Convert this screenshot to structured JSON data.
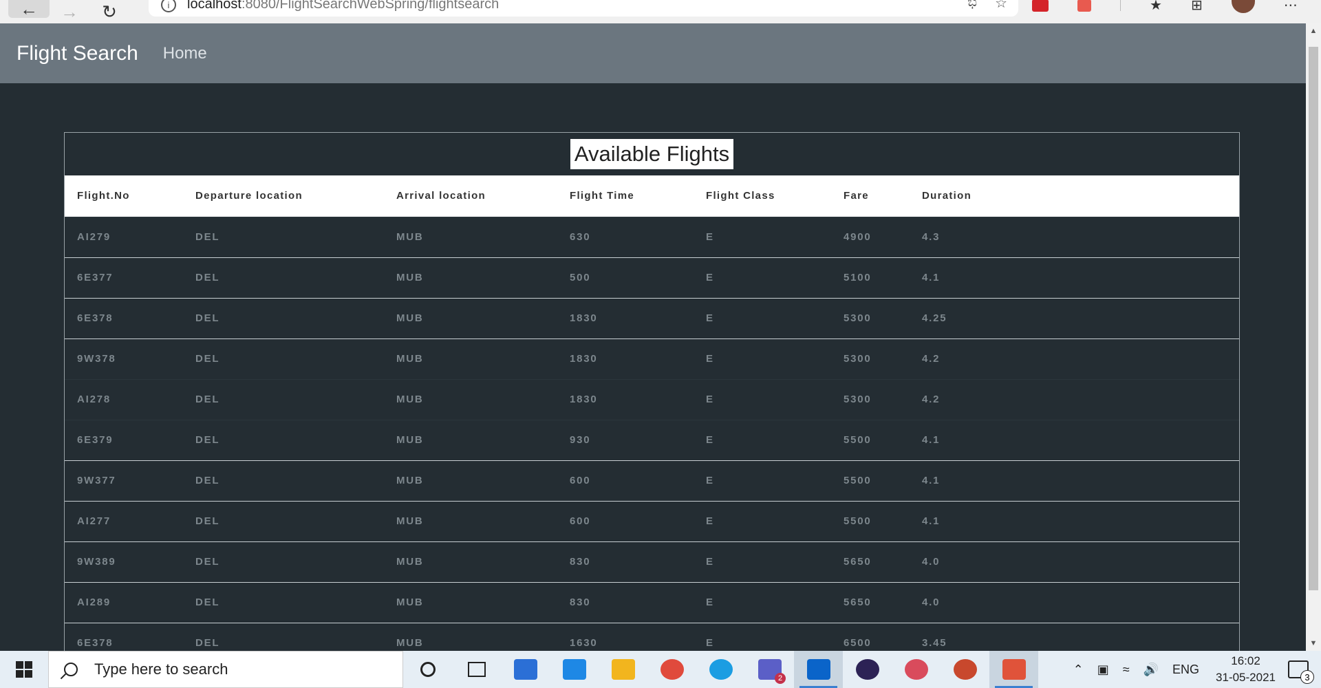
{
  "browser": {
    "url_host": "localhost",
    "url_path": ":8080/FlightSearchWebSpring/flightsearch"
  },
  "navbar": {
    "brand": "Flight Search",
    "home_link": "Home"
  },
  "table": {
    "caption": "Available Flights",
    "columns": [
      "Flight.No",
      "Departure location",
      "Arrival location",
      "Flight Time",
      "Flight Class",
      "Fare",
      "Duration"
    ],
    "rows": [
      [
        "AI279",
        "DEL",
        "MUB",
        "630",
        "E",
        "4900",
        "4.3"
      ],
      [
        "6E377",
        "DEL",
        "MUB",
        "500",
        "E",
        "5100",
        "4.1"
      ],
      [
        "6E378",
        "DEL",
        "MUB",
        "1830",
        "E",
        "5300",
        "4.25"
      ],
      [
        "9W378",
        "DEL",
        "MUB",
        "1830",
        "E",
        "5300",
        "4.2"
      ],
      [
        "AI278",
        "DEL",
        "MUB",
        "1830",
        "E",
        "5300",
        "4.2"
      ],
      [
        "6E379",
        "DEL",
        "MUB",
        "930",
        "E",
        "5500",
        "4.1"
      ],
      [
        "9W377",
        "DEL",
        "MUB",
        "600",
        "E",
        "5500",
        "4.1"
      ],
      [
        "AI277",
        "DEL",
        "MUB",
        "600",
        "E",
        "5500",
        "4.1"
      ],
      [
        "9W389",
        "DEL",
        "MUB",
        "830",
        "E",
        "5650",
        "4.0"
      ],
      [
        "AI289",
        "DEL",
        "MUB",
        "830",
        "E",
        "5650",
        "4.0"
      ],
      [
        "6E378",
        "DEL",
        "MUB",
        "1630",
        "E",
        "6500",
        "3.45"
      ]
    ]
  },
  "taskbar": {
    "search_placeholder": "Type here to search",
    "teams_badge": "2",
    "language": "ENG",
    "time": "16:02",
    "date": "31-05-2021",
    "notification_count": "3",
    "app_icons": [
      {
        "name": "store-icon",
        "color": "#2b6fd6"
      },
      {
        "name": "mail-icon",
        "color": "#1e88e5"
      },
      {
        "name": "file-explorer-icon",
        "color": "#f2b51e"
      },
      {
        "name": "chrome-icon",
        "color": "#e04a3c"
      },
      {
        "name": "edge-icon",
        "color": "#1b9de2"
      },
      {
        "name": "teams-icon",
        "color": "#5b5fc7"
      },
      {
        "name": "outlook-icon",
        "color": "#0a64c9"
      },
      {
        "name": "eclipse-icon",
        "color": "#2c2255"
      },
      {
        "name": "snipping-icon",
        "color": "#d94b5c"
      },
      {
        "name": "powerpoint-icon",
        "color": "#c8482d"
      },
      {
        "name": "snip-sketch-icon",
        "color": "#e0533a"
      }
    ]
  }
}
